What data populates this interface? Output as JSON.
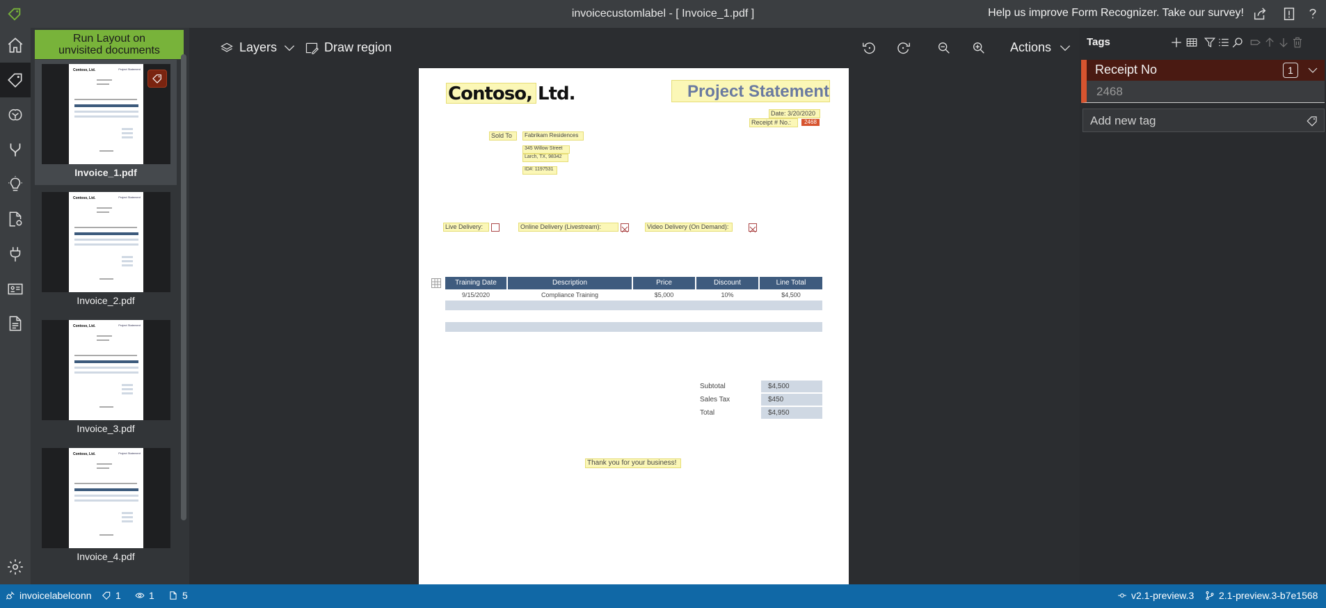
{
  "titlebar": {
    "title": "invoicecustomlabel - [ Invoice_1.pdf ]",
    "survey": "Help us improve Form Recognizer. Take our survey!"
  },
  "sidebar": {
    "run_layout_line1": "Run Layout on",
    "run_layout_line2": "unvisited documents",
    "documents": [
      {
        "name": "Invoice_1.pdf",
        "selected": true,
        "tagged": true
      },
      {
        "name": "Invoice_2.pdf",
        "selected": false,
        "tagged": false
      },
      {
        "name": "Invoice_3.pdf",
        "selected": false,
        "tagged": false
      },
      {
        "name": "Invoice_4.pdf",
        "selected": false,
        "tagged": false
      }
    ]
  },
  "toolbar": {
    "layers": "Layers",
    "draw_region": "Draw region",
    "actions": "Actions"
  },
  "document": {
    "company": "Contoso, Ltd.",
    "title": "Project Statement",
    "date": "Date: 3/20/2020",
    "receipt_label": "Receipt # No.:",
    "receipt_value": "2468",
    "sold_to": "Sold To",
    "customer": "Fabrikam Residences",
    "address1": "345 Willow Street",
    "address2": "Larch, TX, 98342",
    "id": "ID#: 1197531",
    "live": "Live Delivery:",
    "online": "Online Delivery (Livestream):",
    "video": "Video Delivery (On Demand):",
    "table_headers": [
      "Training Date",
      "Description",
      "Price",
      "Discount",
      "Line Total"
    ],
    "table_row": [
      "9/15/2020",
      "Compliance Training",
      "$5,000",
      "10%",
      "$4,500"
    ],
    "subtotal_label": "Subtotal",
    "subtotal": "$4,500",
    "tax_label": "Sales Tax",
    "tax": "$450",
    "total_label": "Total",
    "total": "$4,950",
    "thanks": "Thank you for your business!"
  },
  "mini": {
    "company": "Contoso, Ltd.",
    "title": "Project Statement"
  },
  "tags": {
    "title": "Tags",
    "items": [
      {
        "name": "Receipt No",
        "count": "1",
        "value": "2468",
        "color": "#d7542f"
      }
    ],
    "add_placeholder": "Add new tag"
  },
  "status": {
    "connection": "invoicelabelconn",
    "tag_count": "1",
    "visited": "1",
    "doc_count": "5",
    "api_version": "v2.1-preview.3",
    "build": "2.1-preview.3-b7e1568"
  },
  "colors": {
    "accent": "#78b33a",
    "statusbar": "#1068a6",
    "tag": "#d7542f"
  }
}
